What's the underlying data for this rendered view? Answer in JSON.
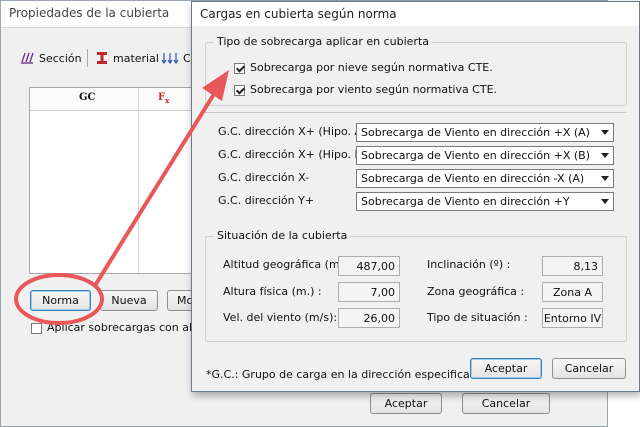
{
  "back_window": {
    "title": "Propiedades de la cubierta",
    "tabs": [
      {
        "label": "Sección",
        "icon": "section-hatch-icon"
      },
      {
        "label": "material",
        "icon": "i-beam-icon"
      },
      {
        "label": "C",
        "icon": "loads-arrows-icon"
      }
    ],
    "table": {
      "columns": [
        "GC",
        "F",
        "x"
      ]
    },
    "buttons": {
      "norma": "Norma",
      "nueva": "Nueva",
      "more": "Mo"
    },
    "checkbox_label": "Aplicar sobrecargas con altern",
    "accept": "Aceptar",
    "cancel": "Cancelar"
  },
  "dialog": {
    "title": "Cargas en cubierta según norma",
    "group_type": {
      "title": "Tipo de sobrecarga aplicar en cubierta",
      "checks": [
        {
          "label": "Sobrecarga por nieve según normativa CTE.",
          "checked": true
        },
        {
          "label": "Sobrecarga por viento según normativa CTE.",
          "checked": true
        }
      ]
    },
    "load_groups": [
      {
        "label": "G.C. dirección X+ (Hipo. A)",
        "value": "Sobrecarga de Viento en dirección +X (A)"
      },
      {
        "label": "G.C. dirección X+ (Hipo. B)",
        "value": "Sobrecarga de Viento en dirección +X (B)"
      },
      {
        "label": "G.C. dirección X-",
        "value": "Sobrecarga de Viento en dirección -X (A)"
      },
      {
        "label": "G.C. dirección Y+",
        "value": "Sobrecarga de Viento en dirección +Y"
      }
    ],
    "situation": {
      "title": "Situación de la cubierta",
      "left": [
        {
          "label": "Altitud geográfica (m.):",
          "value": "487,00"
        },
        {
          "label": "Altura física (m.) :",
          "value": "7,00"
        },
        {
          "label": "Vel. del viento (m/s):",
          "value": "26,00"
        }
      ],
      "right": [
        {
          "label": "Inclinación (º) :",
          "value": "8,13"
        },
        {
          "label": "Zona geográfica :",
          "value": "Zona A"
        },
        {
          "label": "Tipo de situación :",
          "value": "Entorno IV"
        }
      ]
    },
    "footnote": "*G.C.: Grupo de carga en la dirección especificada",
    "accept": "Aceptar",
    "cancel": "Cancelar"
  },
  "colors": {
    "annotation": "#e8575a",
    "accent": "#3c7fb1"
  }
}
